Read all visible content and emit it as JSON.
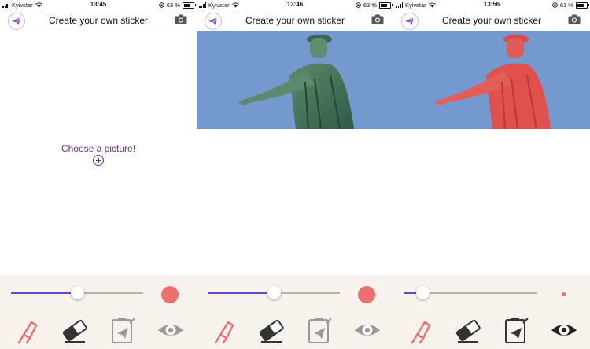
{
  "screens": [
    {
      "status": {
        "carrier": "Kyivstar",
        "time": "13:45",
        "battery": "63 %",
        "battery_level": 0.63
      },
      "nav": {
        "title": "Create your own sticker"
      },
      "canvas": {
        "prompt": "Choose a picture!"
      },
      "slider": {
        "value": 0.5
      },
      "brush": {
        "size": "large",
        "color": "#ee6f6f"
      }
    },
    {
      "status": {
        "carrier": "Kyivstar",
        "time": "13:46",
        "battery": "63 %",
        "battery_level": 0.63
      },
      "nav": {
        "title": "Create your own sticker"
      },
      "slider": {
        "value": 0.5
      },
      "brush": {
        "size": "large",
        "color": "#ee6f6f"
      }
    },
    {
      "status": {
        "carrier": "Kyivstar",
        "time": "13:56",
        "battery": "61 %",
        "battery_level": 0.61
      },
      "nav": {
        "title": "Create your own sticker"
      },
      "slider": {
        "value": 0.14
      },
      "brush": {
        "size": "small",
        "color": "#ee6f6f"
      }
    }
  ],
  "colors": {
    "accent": "#6a45c8",
    "text_accent": "#6c2e96",
    "brush": "#ee6f6f",
    "photo_sky": "#7499cf",
    "toolbar_bg": "#f7f3ec"
  },
  "icons": {
    "logo": "paper-plane-logo-icon",
    "camera": "camera-icon",
    "tools": [
      "brush-tool-icon",
      "eraser-tool-icon",
      "clipboard-preview-icon",
      "eye-icon"
    ]
  }
}
